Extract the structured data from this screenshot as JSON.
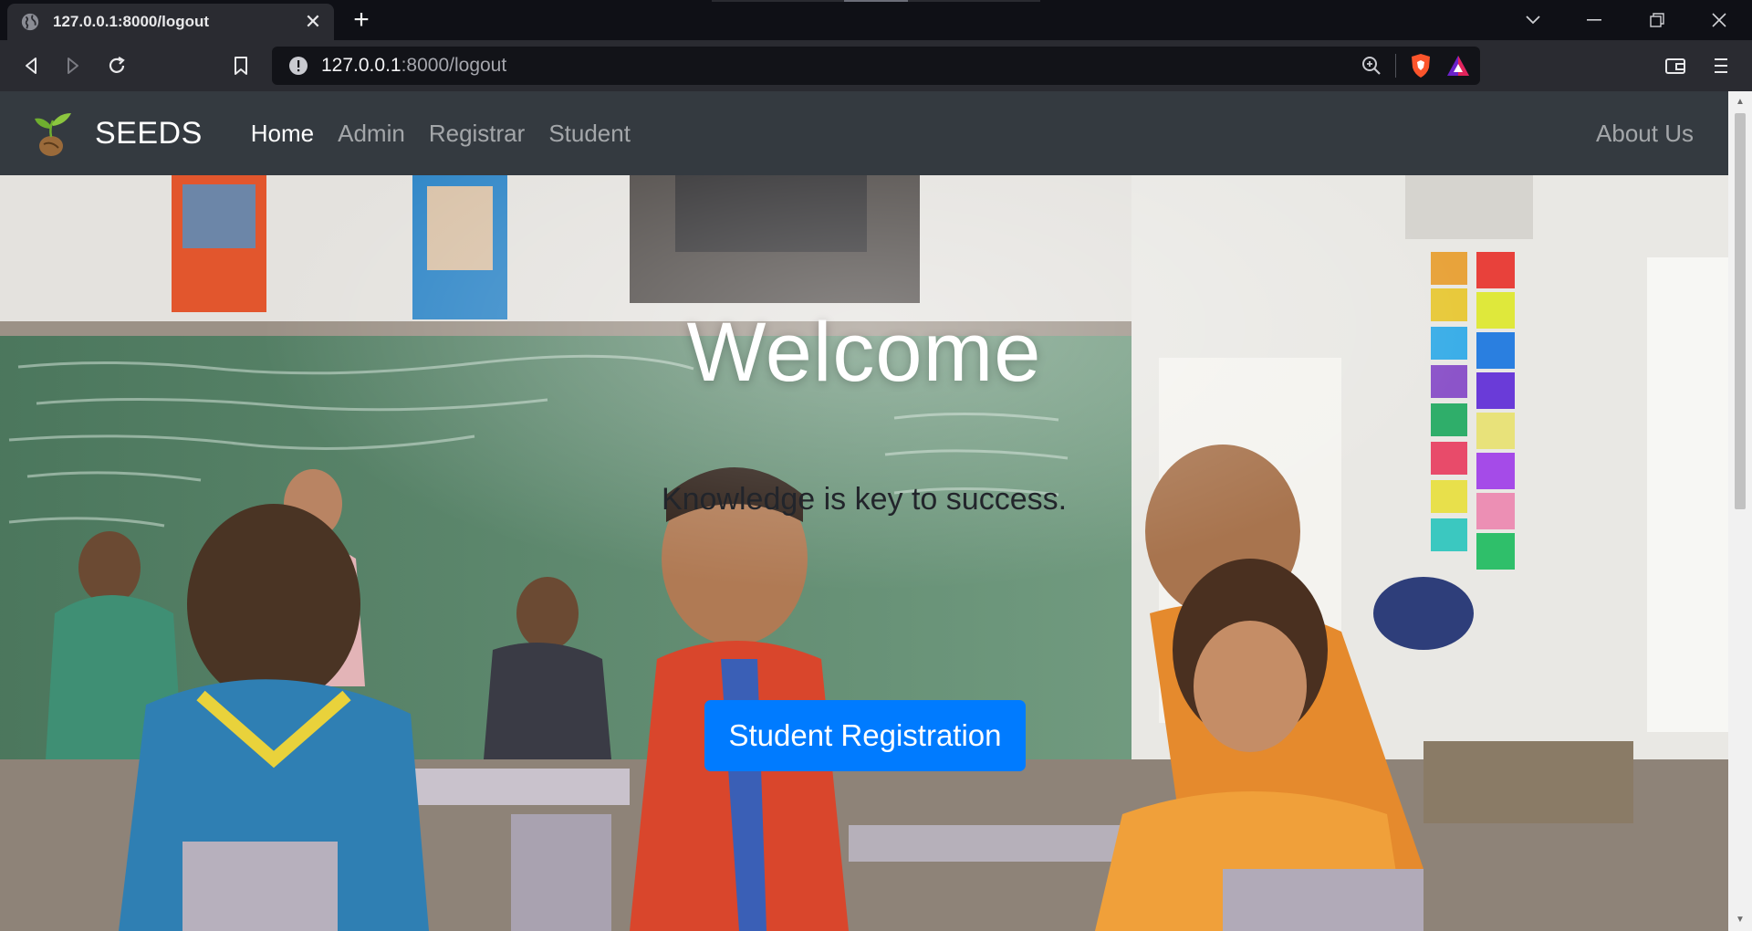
{
  "browser": {
    "tab_title": "127.0.0.1:8000/logout",
    "url_host": "127.0.0.1",
    "url_path": ":8000/logout"
  },
  "navbar": {
    "brand": "SEEDS",
    "links": [
      "Home",
      "Admin",
      "Registrar",
      "Student"
    ],
    "right_link": "About Us",
    "active_link": "Home"
  },
  "hero": {
    "title": "Welcome",
    "subtitle": "Knowledge is key to success.",
    "button_label": "Student Registration"
  },
  "colors": {
    "navbar_bg": "#343a40",
    "primary_button": "#007bff",
    "chrome_bg": "#2a2b31"
  }
}
